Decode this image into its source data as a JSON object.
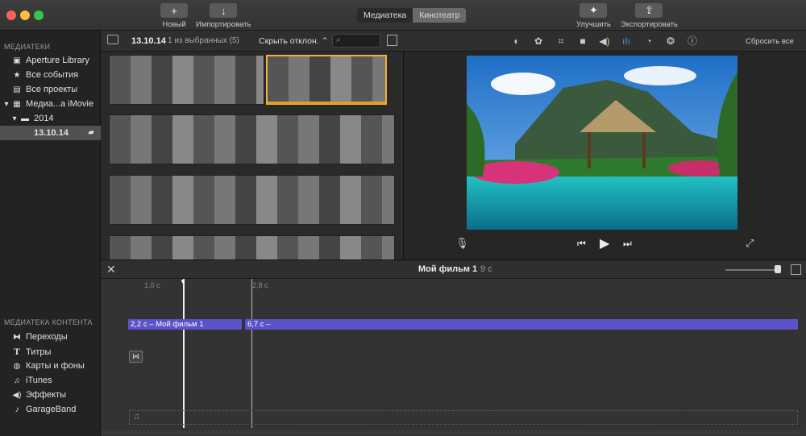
{
  "toolbar": {
    "new_label": "Новый",
    "import_label": "Импортировать",
    "enhance_label": "Улучшить",
    "export_label": "Экспортировать",
    "tab_library": "Медиатека",
    "tab_theater": "Кинотеатр"
  },
  "sidebar": {
    "libraries_heading": "МЕДИАТЕКИ",
    "items": [
      {
        "label": "Aperture Library",
        "icon": "aperture-icon"
      },
      {
        "label": "Все события",
        "icon": "star-icon"
      },
      {
        "label": "Все проекты",
        "icon": "film-icon"
      },
      {
        "label": "Медиа...а iMovie",
        "icon": "grid-icon"
      },
      {
        "label": "2014",
        "icon": "folder-icon"
      },
      {
        "label": "13.10.14",
        "icon": "clapper-icon"
      }
    ],
    "content_heading": "МЕДИАТЕКА КОНТЕНТА",
    "content_items": [
      {
        "label": "Переходы",
        "icon": "transitions-icon"
      },
      {
        "label": "Титры",
        "icon": "titles-icon"
      },
      {
        "label": "Карты и фоны",
        "icon": "globe-icon"
      },
      {
        "label": "iTunes",
        "icon": "music-note-icon"
      },
      {
        "label": "Эффекты",
        "icon": "speaker-icon"
      },
      {
        "label": "GarageBand",
        "icon": "guitar-icon"
      }
    ]
  },
  "browser": {
    "event_name": "13.10.14",
    "selection_info": "1 из выбранных (5)",
    "filter_label": "Скрыть отклон."
  },
  "viewer": {
    "reset_all": "Сбросить все"
  },
  "timeline": {
    "project_title": "Мой фильм 1",
    "project_duration": "9 с",
    "ruler_marks": [
      "1,0 с",
      "2,8 с"
    ],
    "clips": [
      {
        "label": "2,2 с – Мой фильм 1"
      },
      {
        "label": "6,7 с –"
      }
    ]
  }
}
